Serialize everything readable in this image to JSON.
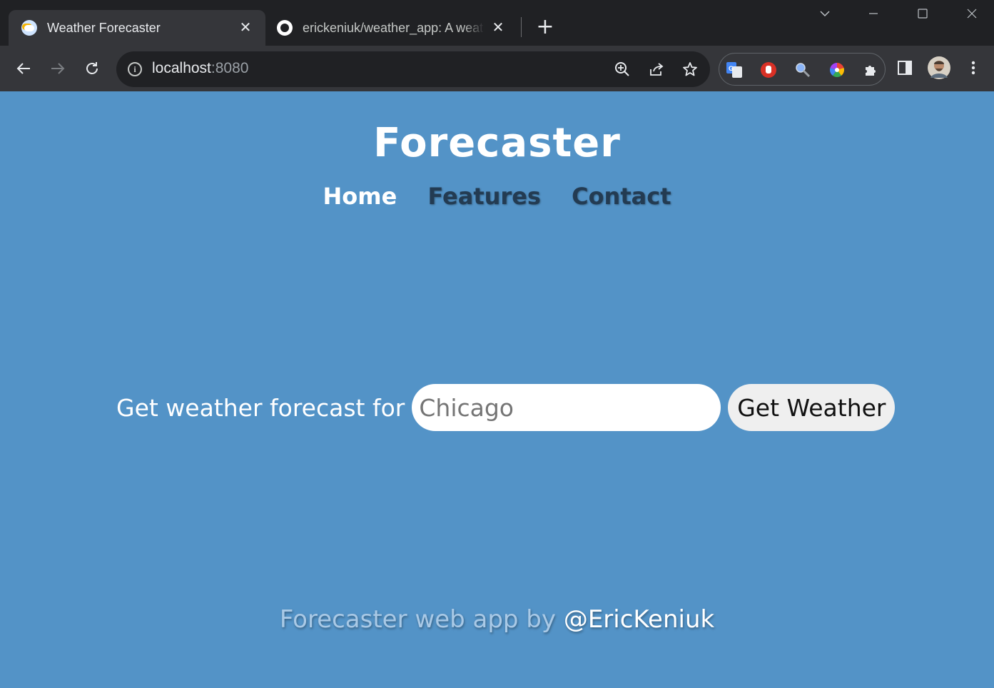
{
  "browser": {
    "tabs": [
      {
        "title": "Weather Forecaster",
        "active": true,
        "icon": "weather-cloud-icon"
      },
      {
        "title": "erickeniuk/weather_app: A weath",
        "active": false,
        "icon": "github-icon"
      }
    ],
    "close_glyph": "✕",
    "new_tab_glyph": "+",
    "address": {
      "host": "localhost",
      "port": ":8080"
    },
    "window_controls": {
      "tab_search": "⌵",
      "minimize": "—",
      "maximize": "☐",
      "close": "✕"
    }
  },
  "site": {
    "title": "Forecaster",
    "nav": {
      "home": "Home",
      "features": "Features",
      "contact": "Contact"
    },
    "search": {
      "label": "Get weather forecast for",
      "placeholder": "Chicago",
      "button": "Get Weather"
    },
    "footer": {
      "lead": "Forecaster web app by ",
      "handle": "@EricKeniuk"
    }
  },
  "colors": {
    "page_background": "#5393c7",
    "nav_active": "#ffffff",
    "nav_inactive": "#233b52",
    "chrome_dark": "#202124",
    "chrome_toolbar": "#35363a"
  }
}
